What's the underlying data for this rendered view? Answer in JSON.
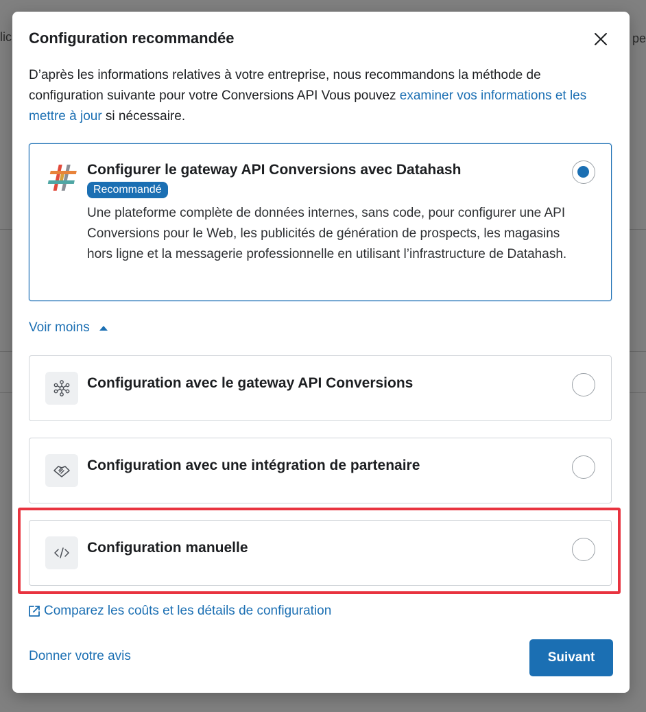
{
  "background": {
    "fragment_left": "lic",
    "fragment_right": "pe"
  },
  "modal": {
    "title": "Configuration recommandée",
    "intro_text": "D’après les informations relatives à votre entreprise, nous recommandons la méthode de configuration suivante pour votre Conversions API Vous pouvez ",
    "intro_link": "examiner vos informations et les mettre à jour",
    "intro_suffix": " si nécessaire."
  },
  "recommended": {
    "title": "Configurer le gateway API Conversions avec Datahash",
    "badge": "Recommandé",
    "description": "Une plateforme complète de données internes, sans code, pour configurer une API Conversions pour le Web, les publicités de génération de prospects, les magasins hors ligne et la messagerie professionnelle en utilisant l’infrastructure de Datahash.",
    "selected": true,
    "icon": "datahash-logo-icon"
  },
  "toggle": {
    "label": "Voir moins",
    "icon": "caret-up-icon"
  },
  "options": [
    {
      "title": "Configuration avec le gateway API Conversions",
      "icon": "network-hub-icon",
      "selected": false
    },
    {
      "title": "Configuration avec une intégration de partenaire",
      "icon": "handshake-icon",
      "selected": false
    },
    {
      "title": "Configuration manuelle",
      "icon": "code-icon",
      "selected": false
    }
  ],
  "footer": {
    "compare_link": "Comparez les coûts et les détails de configuration",
    "feedback_link": "Donner votre avis",
    "next_button": "Suivant"
  },
  "colors": {
    "accent": "#1b6fb3",
    "highlight": "#e8333f"
  }
}
